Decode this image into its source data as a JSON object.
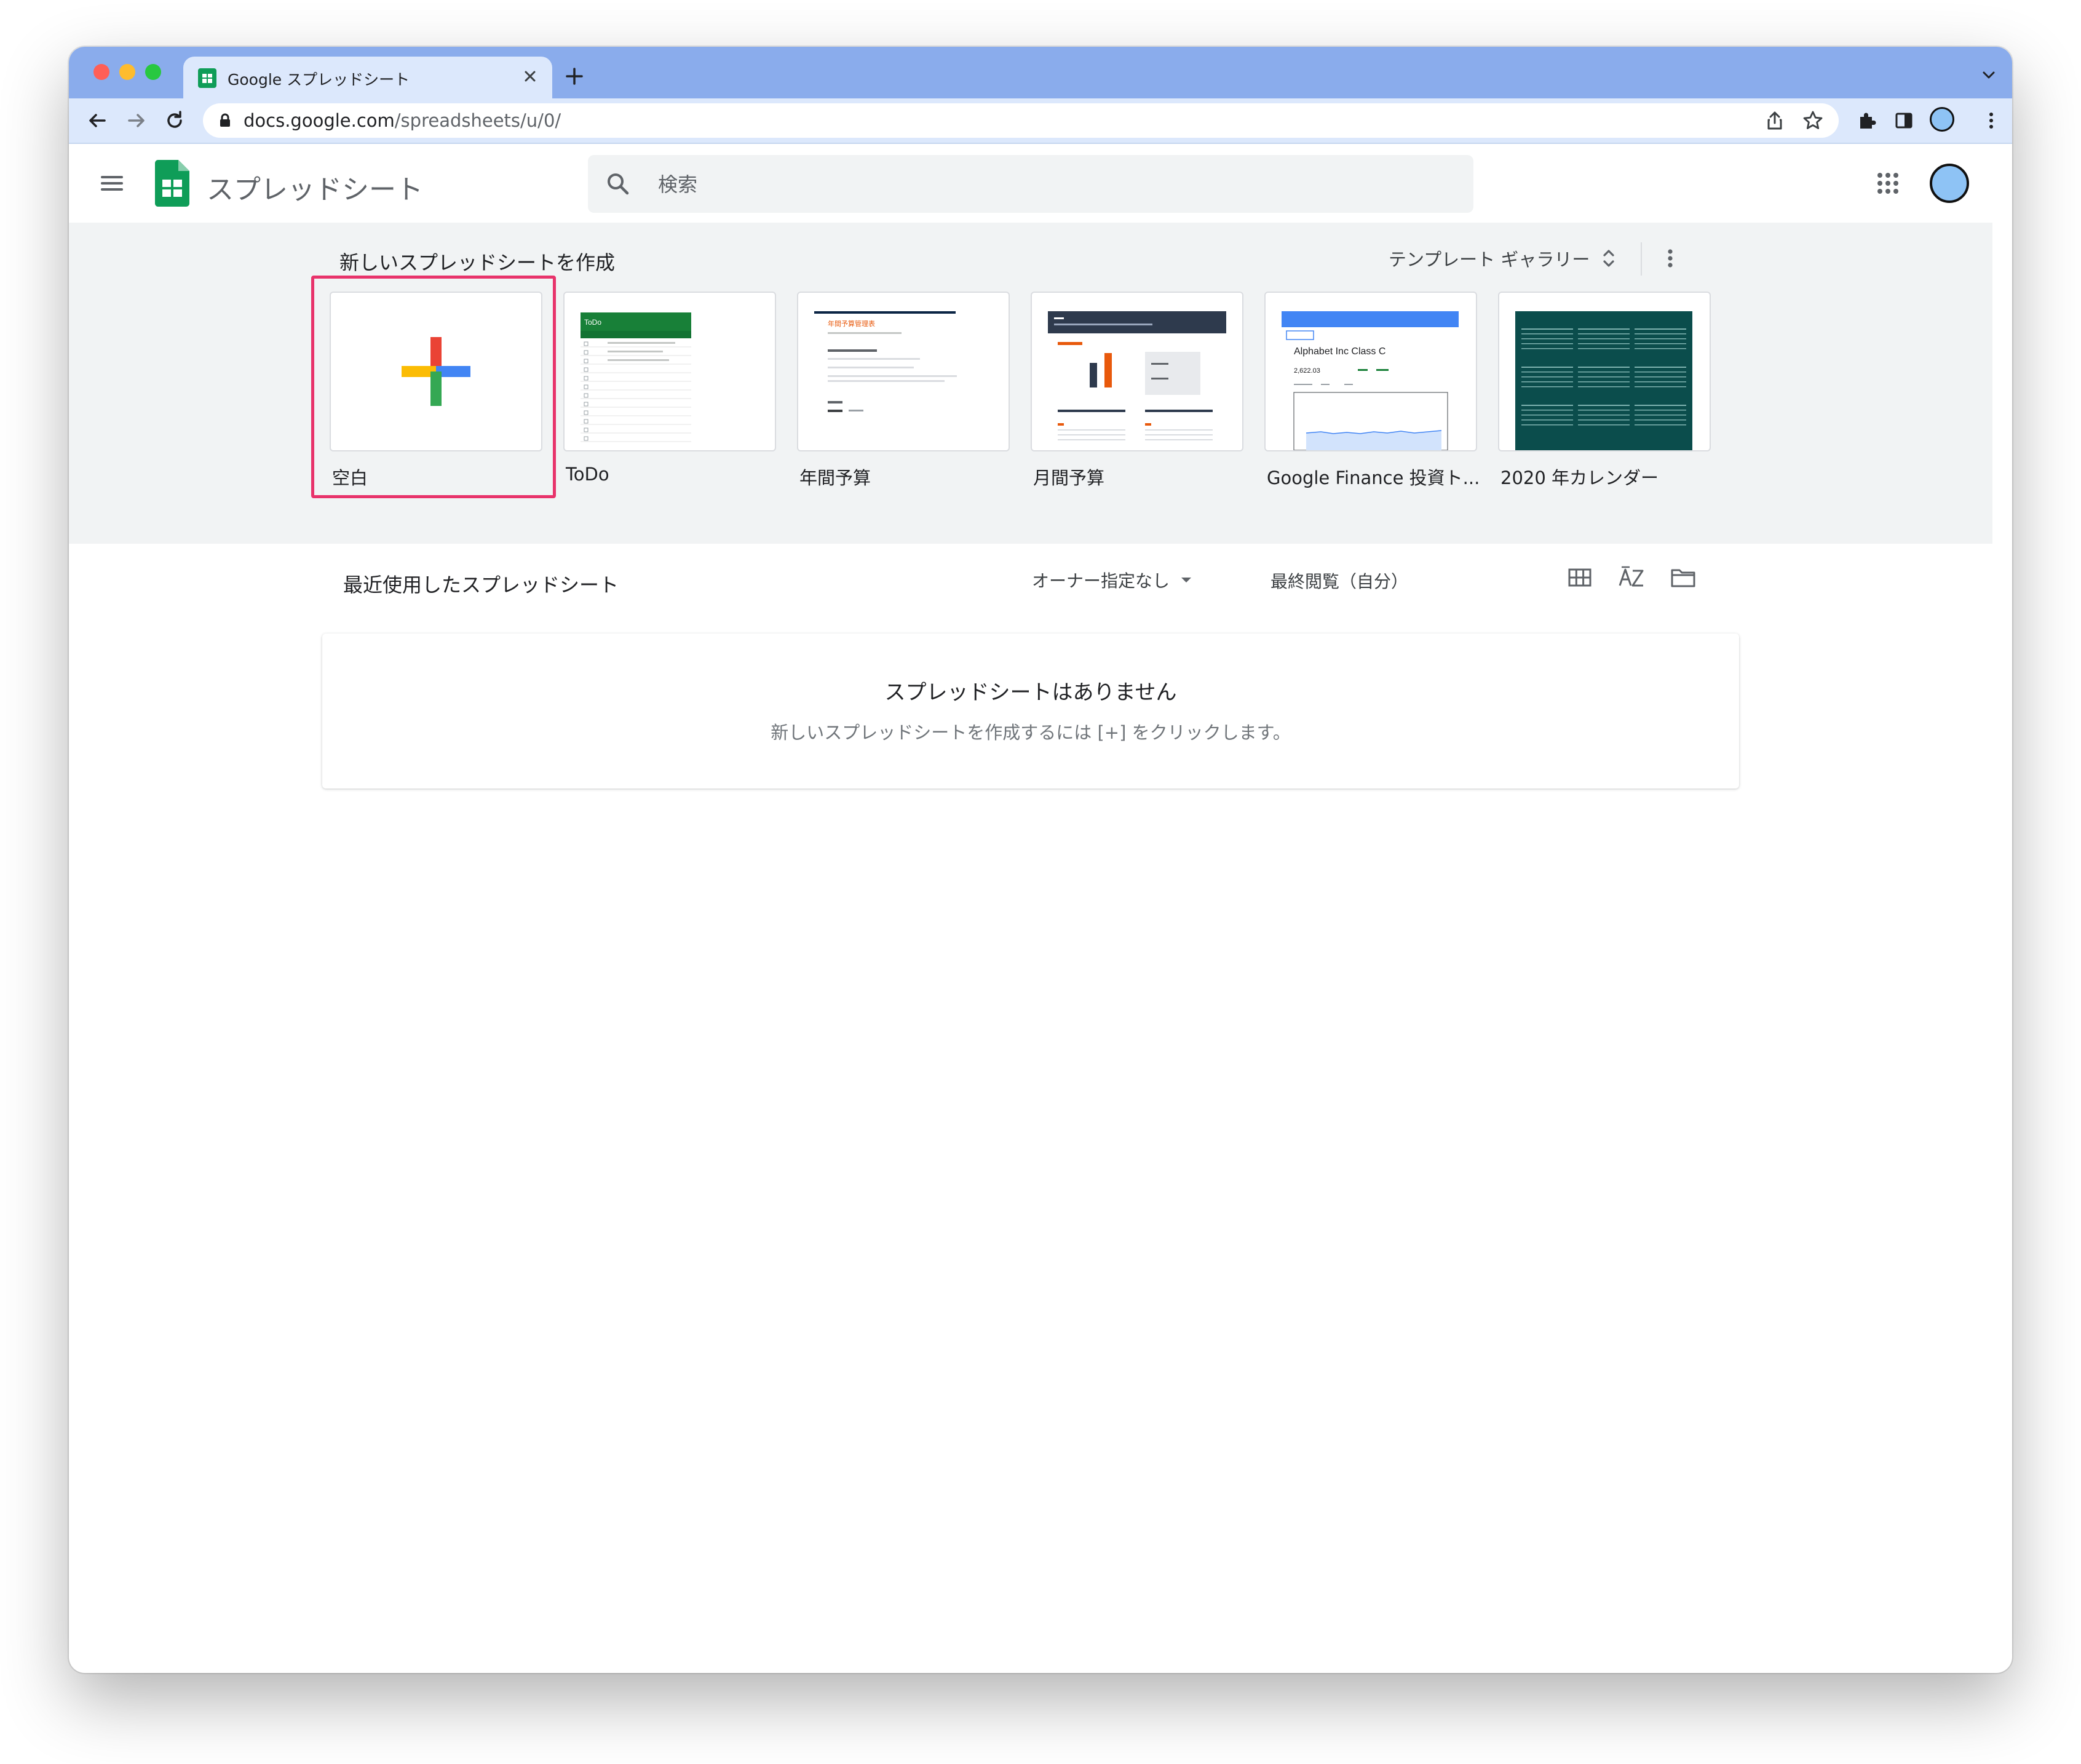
{
  "browser": {
    "tab_title": "Google スプレッドシート",
    "url_host": "docs.google.com",
    "url_path": "/spreadsheets/u/0/",
    "colors": {
      "tabstrip": "#8aacec",
      "toolbar": "#dce8fc"
    }
  },
  "app": {
    "title": "スプレッドシート",
    "search_placeholder": "検索",
    "colors": {
      "sheets_green": "#0f9d58",
      "highlight": "#e8336b"
    }
  },
  "templates": {
    "heading": "新しいスプレッドシートを作成",
    "gallery_label": "テンプレート ギャラリー",
    "items": [
      {
        "label": "空白"
      },
      {
        "label": "ToDo"
      },
      {
        "label": "年間予算"
      },
      {
        "label": "月間予算"
      },
      {
        "label": "Google Finance 投資ト..."
      },
      {
        "label": "2020 年カレンダー"
      }
    ],
    "thumbs": {
      "todo_header": "ToDo",
      "annual_title": "年間予算管理表",
      "finance_name": "Alphabet Inc Class C",
      "finance_price": "2,622.03"
    }
  },
  "recent": {
    "title": "最近使用したスプレッドシート",
    "owner_filter": "オーナー指定なし",
    "sort_label": "最終閲覧（自分）",
    "empty_title": "スプレッドシートはありません",
    "empty_subtitle": "新しいスプレッドシートを作成するには [+] をクリックします。"
  }
}
